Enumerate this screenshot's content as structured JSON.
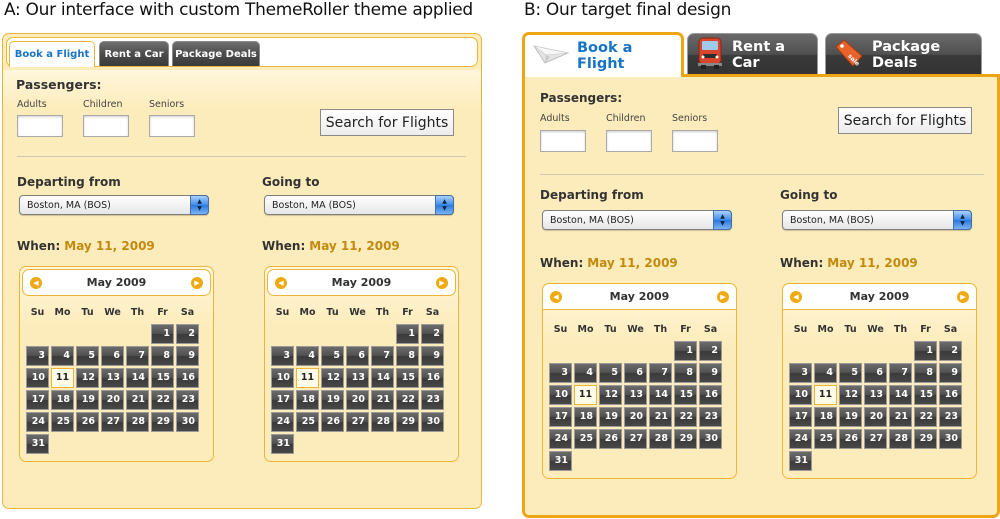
{
  "captions": {
    "a": "A: Our interface with custom ThemeRoller theme applied",
    "b": "B: Our target final design"
  },
  "tabs": [
    {
      "label": "Book a Flight",
      "icon": "paper-plane-icon",
      "active": true
    },
    {
      "label": "Rent a Car",
      "icon": "car-icon",
      "active": false
    },
    {
      "label": "Package Deals",
      "icon": "sale-tag-icon",
      "active": false
    }
  ],
  "form": {
    "passengers_label": "Passengers:",
    "adults_label": "Adults",
    "children_label": "Children",
    "seniors_label": "Seniors",
    "adults_value": "",
    "children_value": "",
    "seniors_value": "",
    "search_button": "Search for Flights",
    "departing_label": "Departing from",
    "going_label": "Going to",
    "departing_value": "Boston, MA (BOS)",
    "going_value": "Boston, MA (BOS)",
    "when_label": "When:",
    "depart_date": "May 11, 2009",
    "return_date": "May 11, 2009"
  },
  "calendar": {
    "month_title": "May 2009",
    "weekdays": [
      "Su",
      "Mo",
      "Tu",
      "We",
      "Th",
      "Fr",
      "Sa"
    ],
    "first_weekday_index": 5,
    "days_in_month": 31,
    "selected_day": 11,
    "prev_icon": "◀",
    "next_icon": "▶"
  },
  "colors": {
    "accent_orange": "#eea514",
    "panel_bg": "#fdecbb",
    "link_blue": "#1874c6",
    "date_gold": "#c38a0f"
  }
}
